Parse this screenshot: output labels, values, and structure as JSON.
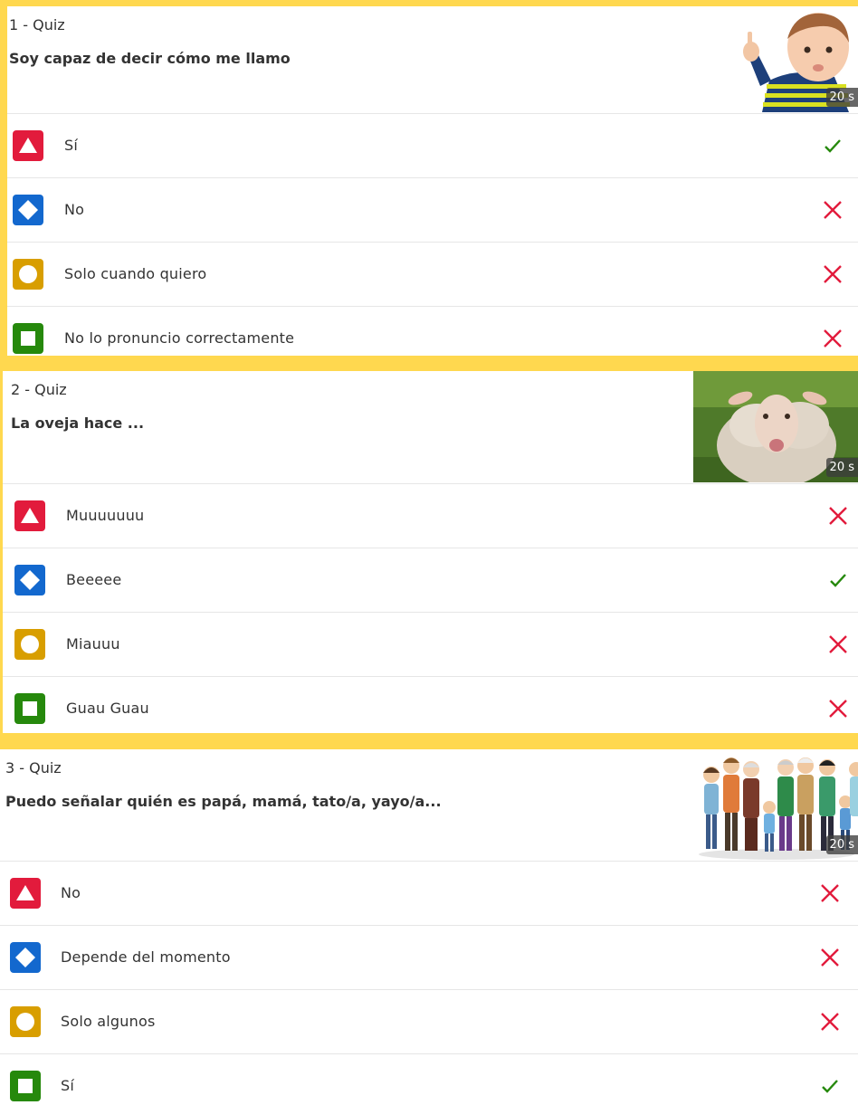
{
  "quizzes": [
    {
      "number": "1 - Quiz",
      "question": "Soy capaz de decir cómo me llamo",
      "time": "20 s",
      "image": "toddler-pointing-photo",
      "answers": [
        {
          "shape": "triangle",
          "color": "#e21b3c",
          "label": "Sí",
          "correct": true
        },
        {
          "shape": "diamond",
          "color": "#1368ce",
          "label": "No",
          "correct": false
        },
        {
          "shape": "circle",
          "color": "#d89e00",
          "label": "Solo cuando quiero",
          "correct": false
        },
        {
          "shape": "square",
          "color": "#26890c",
          "label": "No lo pronuncio correctamente",
          "correct": false
        }
      ]
    },
    {
      "number": "2 - Quiz",
      "question": "La oveja hace ...",
      "time": "20 s",
      "image": "sheep-photo",
      "answers": [
        {
          "shape": "triangle",
          "color": "#e21b3c",
          "label": "Muuuuuuu",
          "correct": false
        },
        {
          "shape": "diamond",
          "color": "#1368ce",
          "label": "Beeeee",
          "correct": true
        },
        {
          "shape": "circle",
          "color": "#d89e00",
          "label": "Miauuu",
          "correct": false
        },
        {
          "shape": "square",
          "color": "#26890c",
          "label": "Guau Guau",
          "correct": false
        }
      ]
    },
    {
      "number": "3 - Quiz",
      "question": "Puedo señalar quién es papá, mamá, tato/a, yayo/a...",
      "time": "20 s",
      "image": "family-illustration",
      "answers": [
        {
          "shape": "triangle",
          "color": "#e21b3c",
          "label": "No",
          "correct": false
        },
        {
          "shape": "diamond",
          "color": "#1368ce",
          "label": "Depende del momento",
          "correct": false
        },
        {
          "shape": "circle",
          "color": "#d89e00",
          "label": "Solo algunos",
          "correct": false
        },
        {
          "shape": "square",
          "color": "#26890c",
          "label": "Sí",
          "correct": true
        }
      ]
    }
  ],
  "colors": {
    "highlight": "#ffd84f",
    "correct": "#26890c",
    "incorrect": "#e21b3c"
  }
}
